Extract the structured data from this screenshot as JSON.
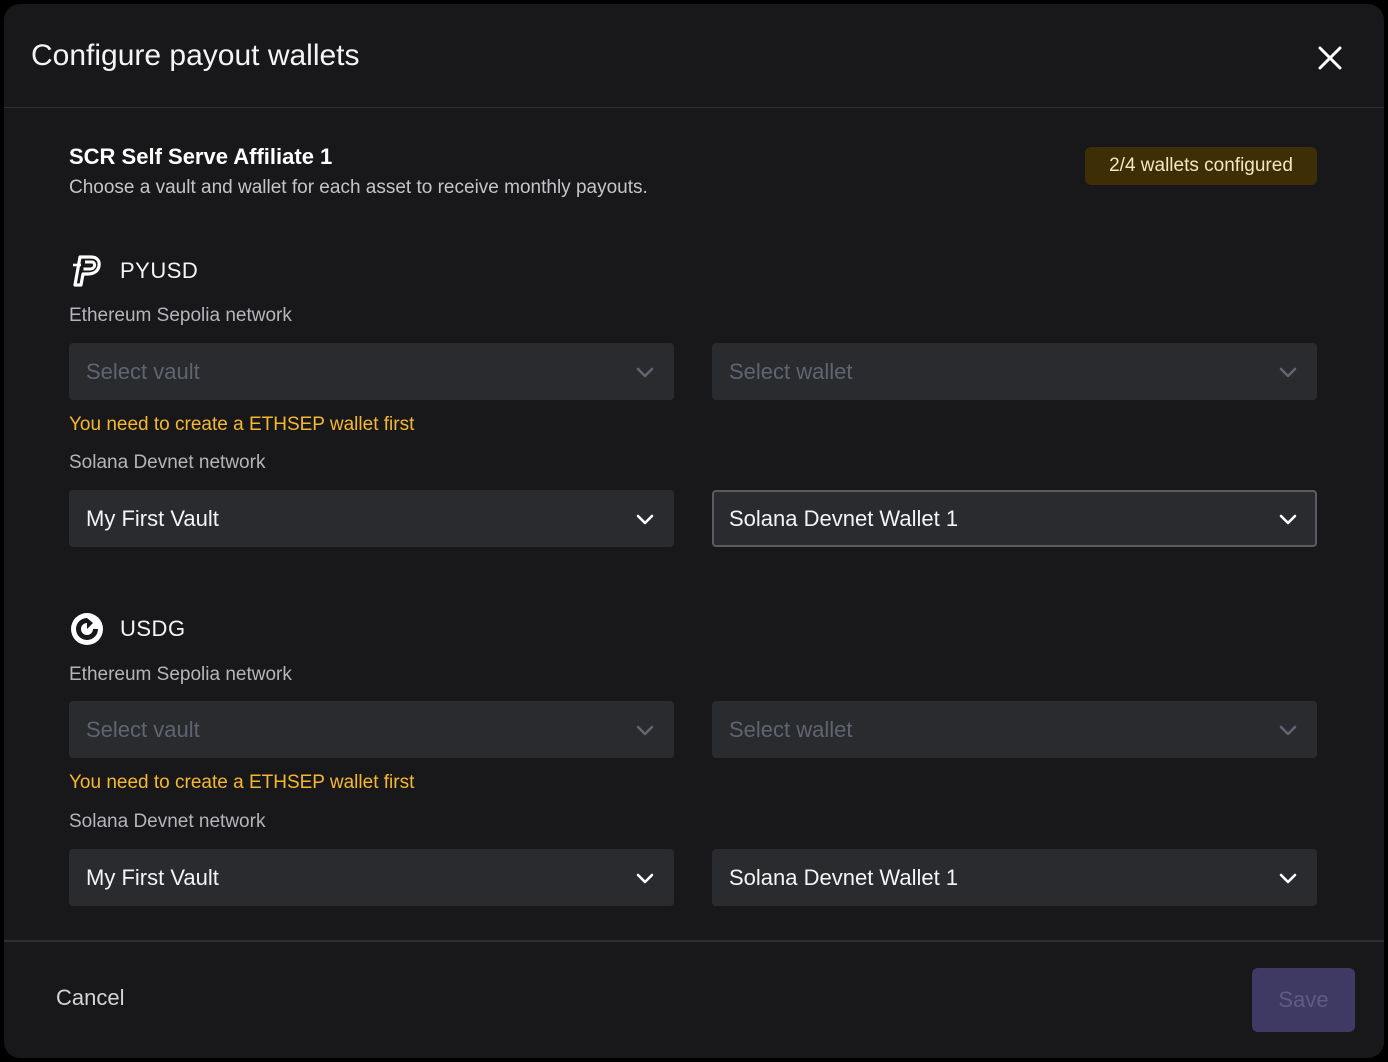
{
  "dialog": {
    "title": "Configure payout wallets",
    "close_icon": "close-icon"
  },
  "affiliate": {
    "name": "SCR Self Serve Affiliate 1",
    "description": "Choose a vault and wallet for each asset to receive monthly payouts.",
    "badge": "2/4 wallets configured",
    "badge_color": "#3d2e05"
  },
  "assets": [
    {
      "name": "PYUSD",
      "icon": "pyusd-icon",
      "networks": [
        {
          "label": "Ethereum Sepolia network",
          "vault": "Select vault",
          "wallet": "Select wallet",
          "warning": "You need to create a ETHSEP wallet first"
        },
        {
          "label": "Solana Devnet network",
          "vault": "My First Vault",
          "wallet": "Solana Devnet Wallet 1"
        }
      ]
    },
    {
      "name": "USDG",
      "icon": "usdg-icon",
      "networks": [
        {
          "label": "Ethereum Sepolia network",
          "vault": "Select vault",
          "wallet": "Select wallet",
          "warning": "You need to create a ETHSEP wallet first"
        },
        {
          "label": "Solana Devnet network",
          "vault": "My First Vault",
          "wallet": "Solana Devnet Wallet 1"
        }
      ]
    }
  ],
  "footer": {
    "cancel_label": "Cancel",
    "save_label": "Save"
  },
  "colors": {
    "background": "#18181b",
    "warning": "#f5b82e",
    "save_disabled": "#3f3a63"
  }
}
